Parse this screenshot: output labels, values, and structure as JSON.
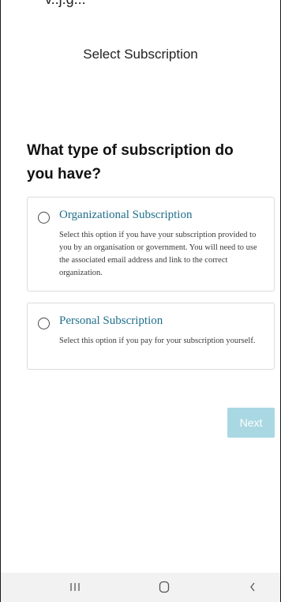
{
  "top_clip_text": "v..j.g...",
  "screen_title": "Select Subscription",
  "question": "What type of subscription do you have?",
  "options": [
    {
      "title": "Organizational Subscription",
      "description": "Select this option if you have your subscription provided to you by an organisation or government. You will need to use the associated email address and link to the correct organization.",
      "selected": false
    },
    {
      "title": "Personal Subscription",
      "description": "Select this option if you pay for your subscription yourself.",
      "selected": false
    }
  ],
  "next_label": "Next",
  "colors": {
    "option_title": "#1f6f8b",
    "next_disabled_bg": "#a9d8e3",
    "nav_bar_bg": "#f2f2f2"
  },
  "nav_bar": {
    "icons": [
      "recents-icon",
      "home-icon",
      "back-icon"
    ]
  }
}
